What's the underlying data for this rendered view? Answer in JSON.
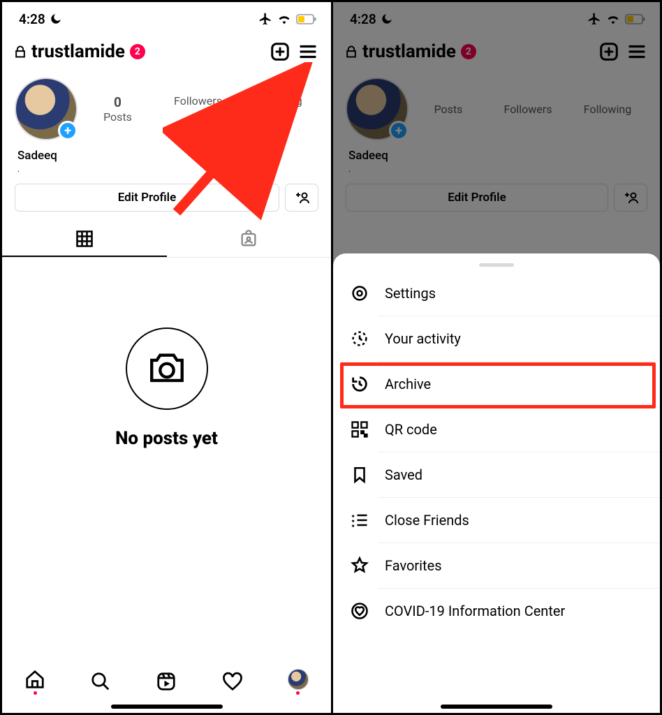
{
  "status": {
    "time": "4:28"
  },
  "profile": {
    "username": "trustlamide",
    "badge_count": "2",
    "display_name": "Sadeeq",
    "stats": {
      "posts_count": "0",
      "posts_label": "Posts",
      "followers_label": "Followers",
      "following_label": "Following"
    },
    "edit_profile_label": "Edit Profile",
    "empty_state": "No posts yet"
  },
  "menu": {
    "items": [
      {
        "label": "Settings",
        "icon": "settings-icon"
      },
      {
        "label": "Your activity",
        "icon": "activity-icon"
      },
      {
        "label": "Archive",
        "icon": "archive-icon"
      },
      {
        "label": "QR code",
        "icon": "qrcode-icon"
      },
      {
        "label": "Saved",
        "icon": "saved-icon"
      },
      {
        "label": "Close Friends",
        "icon": "close-friends-icon"
      },
      {
        "label": "Favorites",
        "icon": "favorites-icon"
      },
      {
        "label": "COVID-19 Information Center",
        "icon": "covid-icon"
      }
    ],
    "highlighted_index": 2
  }
}
